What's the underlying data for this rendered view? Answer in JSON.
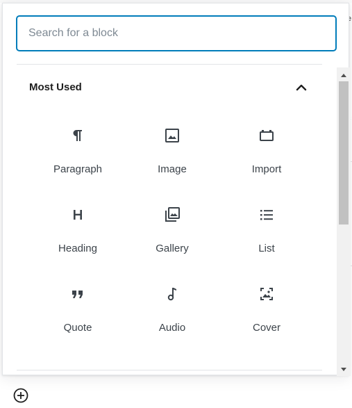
{
  "search": {
    "placeholder": "Search for a block"
  },
  "panel": {
    "title": "Most Used"
  },
  "blocks": [
    {
      "label": "Paragraph",
      "icon": "paragraph-icon"
    },
    {
      "label": "Image",
      "icon": "image-icon"
    },
    {
      "label": "Import",
      "icon": "import-icon"
    },
    {
      "label": "Heading",
      "icon": "heading-icon"
    },
    {
      "label": "Gallery",
      "icon": "gallery-icon"
    },
    {
      "label": "List",
      "icon": "list-icon"
    },
    {
      "label": "Quote",
      "icon": "quote-icon"
    },
    {
      "label": "Audio",
      "icon": "audio-icon"
    },
    {
      "label": "Cover",
      "icon": "cover-icon"
    }
  ],
  "colors": {
    "accent": "#007cba",
    "icon": "#3c434a",
    "text": "#1e1e1e",
    "divider": "#e2e4e7"
  },
  "footer": {
    "add_block_icon": "plus-circle-icon"
  }
}
